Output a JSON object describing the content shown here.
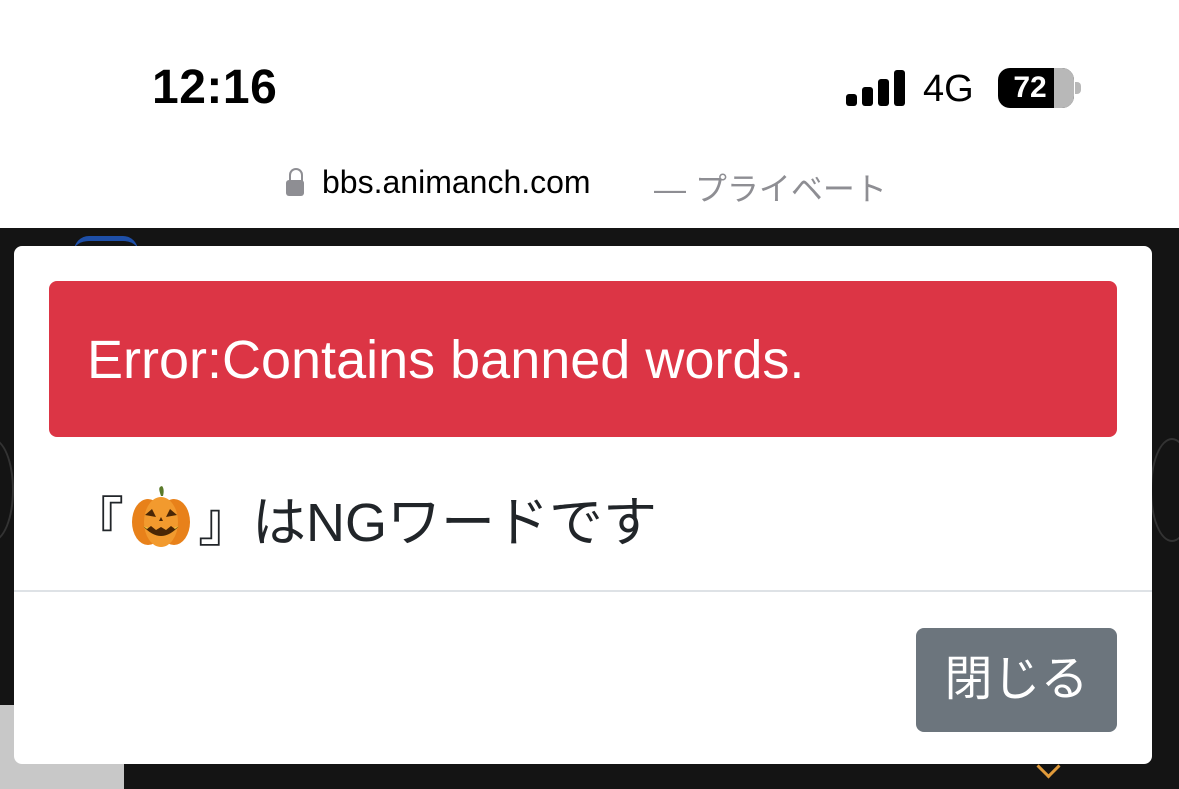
{
  "status_bar": {
    "time": "12:16",
    "network": "4G",
    "battery": "72"
  },
  "url_bar": {
    "domain": "bbs.animanch.com",
    "mode": "— プライベート"
  },
  "modal": {
    "alert_text": "Error:Contains banned words.",
    "message_prefix": "『",
    "message_suffix": "』はNGワードです",
    "emoji_icon": "jack-o-lantern-icon",
    "close_label": "閉じる"
  },
  "colors": {
    "alert": "#dc3545",
    "close_button": "#6c757d",
    "page_background": "#141414"
  }
}
